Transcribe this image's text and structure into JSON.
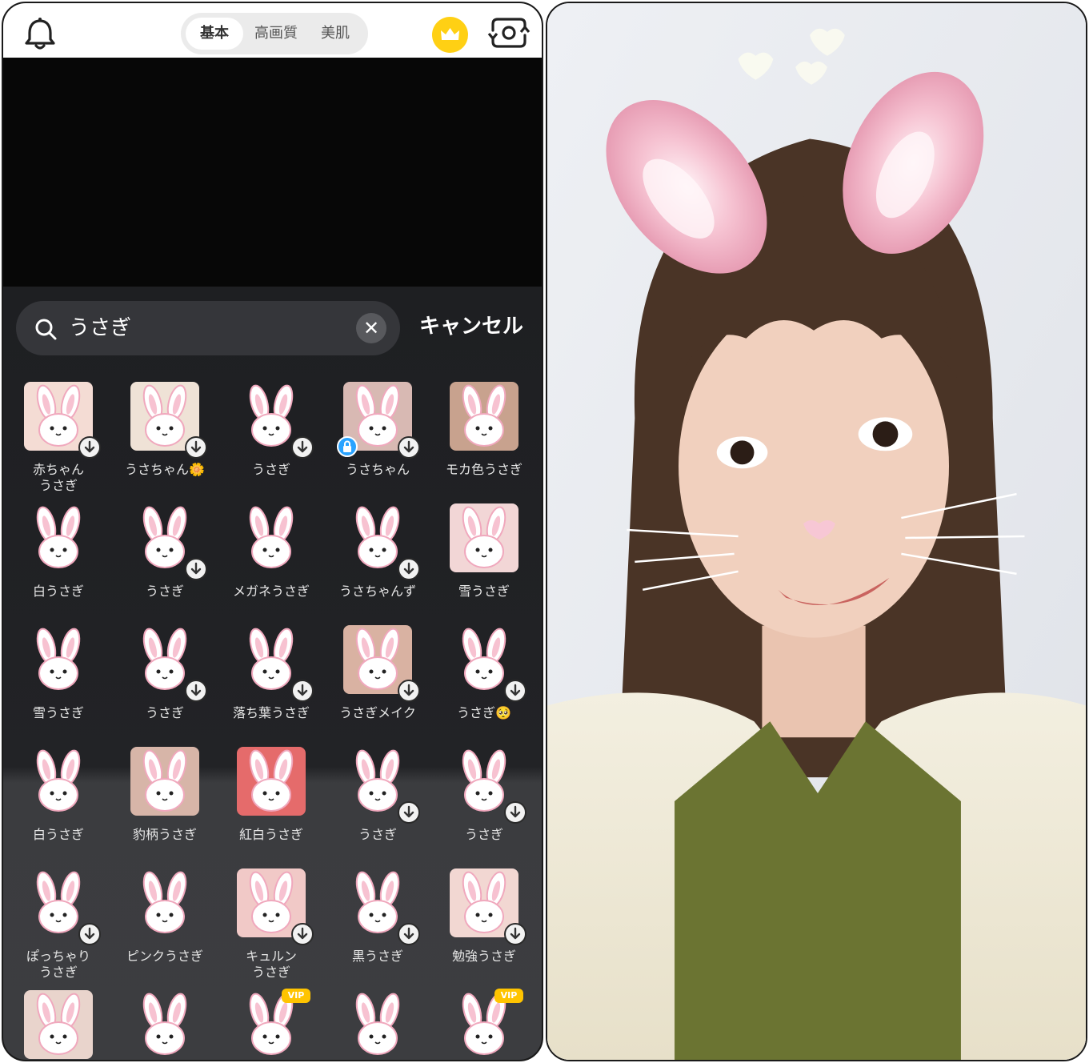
{
  "topbar": {
    "bell_icon": "bell-icon",
    "modes": [
      "基本",
      "高画質",
      "美肌"
    ],
    "active_mode": "基本",
    "crown_icon": "crown-icon",
    "camera_flip_icon": "camera-flip-icon"
  },
  "search": {
    "value": "うさぎ",
    "clear_icon": "close-icon",
    "cancel_label": "キャンセル"
  },
  "stickers": [
    {
      "label": "赤ちゃん\nうさぎ",
      "download": true
    },
    {
      "label": "うさちゃん🌼",
      "download": true
    },
    {
      "label": "うさぎ",
      "download": true
    },
    {
      "label": "うさちゃん",
      "download": true,
      "locked": true
    },
    {
      "label": "モカ色うさぎ",
      "download": false
    },
    {
      "label": "白うさぎ",
      "download": false
    },
    {
      "label": "うさぎ",
      "download": true
    },
    {
      "label": "メガネうさぎ",
      "download": false
    },
    {
      "label": "うさちゃんず",
      "download": true
    },
    {
      "label": "雪うさぎ",
      "download": false
    },
    {
      "label": "雪うさぎ",
      "download": false
    },
    {
      "label": "うさぎ",
      "download": true
    },
    {
      "label": "落ち葉うさぎ",
      "download": true
    },
    {
      "label": "うさぎメイク",
      "download": true
    },
    {
      "label": "うさぎ🥺",
      "download": true
    },
    {
      "label": "白うさぎ",
      "download": false
    },
    {
      "label": "豹柄うさぎ",
      "download": false
    },
    {
      "label": "紅白うさぎ",
      "download": false
    },
    {
      "label": "うさぎ",
      "download": true
    },
    {
      "label": "うさぎ",
      "download": true
    },
    {
      "label": "ぽっちゃり\nうさぎ",
      "download": true
    },
    {
      "label": "ピンクうさぎ",
      "download": false
    },
    {
      "label": "キュルン\nうさぎ",
      "download": true
    },
    {
      "label": "黒うさぎ",
      "download": true
    },
    {
      "label": "勉強うさぎ",
      "download": true
    },
    {
      "label": "",
      "download": false
    },
    {
      "label": "",
      "download": false
    },
    {
      "label": "",
      "download": false,
      "vip": "VIP"
    },
    {
      "label": "",
      "download": false
    },
    {
      "label": "",
      "download": false,
      "vip": "VIP"
    }
  ],
  "colors": {
    "accent_yellow": "#ffd014",
    "sheet_dark": "#1e1f22",
    "sheet_gray": "#3c3d40",
    "lock_blue": "#2aa3ff",
    "ear_pink": "#f3b6c8"
  }
}
